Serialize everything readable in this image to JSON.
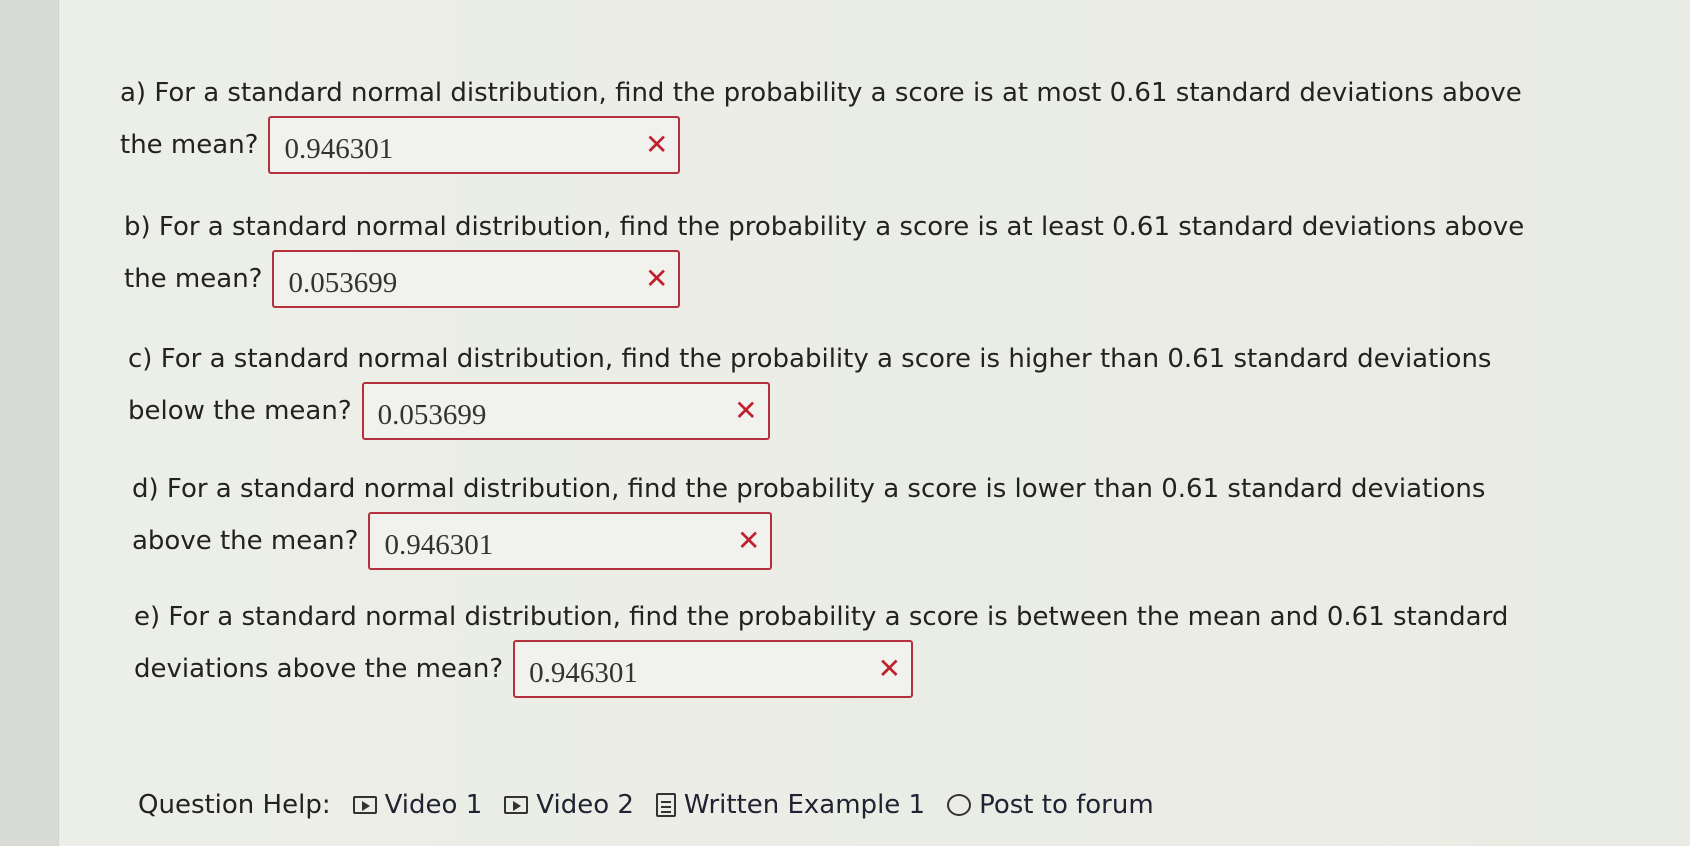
{
  "questions": [
    {
      "line1": "a) For a standard normal distribution, find the probability a score is at most 0.61 standard deviations above",
      "line2": "the mean?",
      "answer": "0.946301",
      "status_mark": "✕"
    },
    {
      "line1": "b) For a standard normal distribution, find the probability a score is at least 0.61 standard deviations above",
      "line2": "the mean?",
      "answer": "0.053699",
      "status_mark": "✕"
    },
    {
      "line1": "c) For a standard normal distribution, find the probability a score is higher than 0.61 standard deviations",
      "line2": "below the mean?",
      "answer": "0.053699",
      "status_mark": "✕"
    },
    {
      "line1": "d) For a standard normal distribution, find the probability a score is lower than 0.61 standard deviations",
      "line2": "above the mean?",
      "answer": "0.946301",
      "status_mark": "✕"
    },
    {
      "line1": "e) For a standard normal distribution, find the probability a score is between the mean and 0.61 standard",
      "line2": "deviations above the mean?",
      "answer": "0.946301",
      "status_mark": "✕"
    }
  ],
  "help": {
    "label": "Question Help:",
    "links": [
      {
        "label": "Video 1",
        "icon": "video-icon"
      },
      {
        "label": "Video 2",
        "icon": "video-icon"
      },
      {
        "label": "Written Example 1",
        "icon": "document-icon"
      },
      {
        "label": "Post to forum",
        "icon": "speech-bubble-icon"
      }
    ]
  },
  "colors": {
    "error_border": "#b5303c",
    "error_mark": "#c0202e",
    "background": "#e9ece6"
  }
}
